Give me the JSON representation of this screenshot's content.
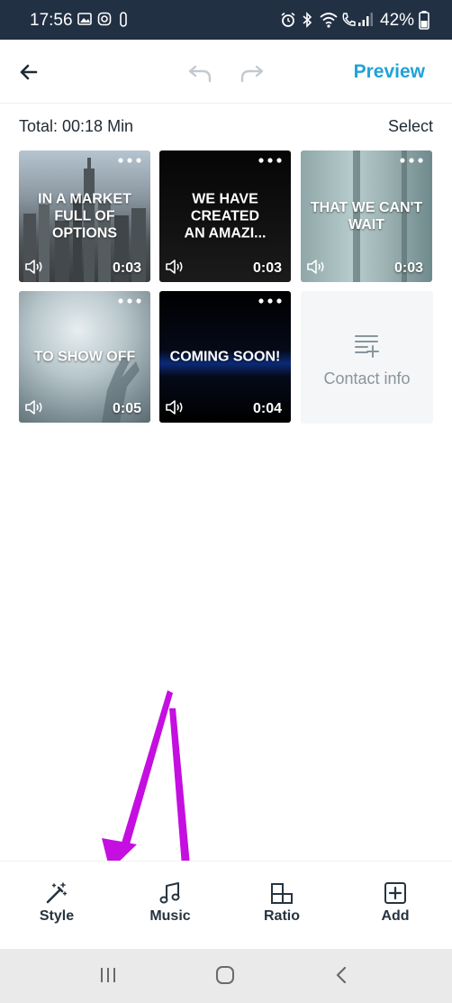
{
  "status_bar": {
    "time": "17:56",
    "battery": "42%"
  },
  "header": {
    "preview_label": "Preview"
  },
  "summary": {
    "total": "Total: 00:18 Min",
    "select_label": "Select"
  },
  "clips": [
    {
      "caption": "IN A MARKET FULL OF OPTIONS",
      "duration": "0:03"
    },
    {
      "caption": "WE HAVE CREATED AN AMAZI...",
      "duration": "0:03"
    },
    {
      "caption": "THAT WE CAN'T WAIT",
      "duration": "0:03"
    },
    {
      "caption": "TO SHOW OFF",
      "duration": "0:05"
    },
    {
      "caption": "COMING SOON!",
      "duration": "0:04"
    }
  ],
  "contact_tile": {
    "label": "Contact info"
  },
  "toolbar": {
    "style_label": "Style",
    "music_label": "Music",
    "ratio_label": "Ratio",
    "add_label": "Add"
  },
  "colors": {
    "accent": "#1fa3d8",
    "status_bar": "#223044",
    "arrow": "#c40fe0"
  }
}
